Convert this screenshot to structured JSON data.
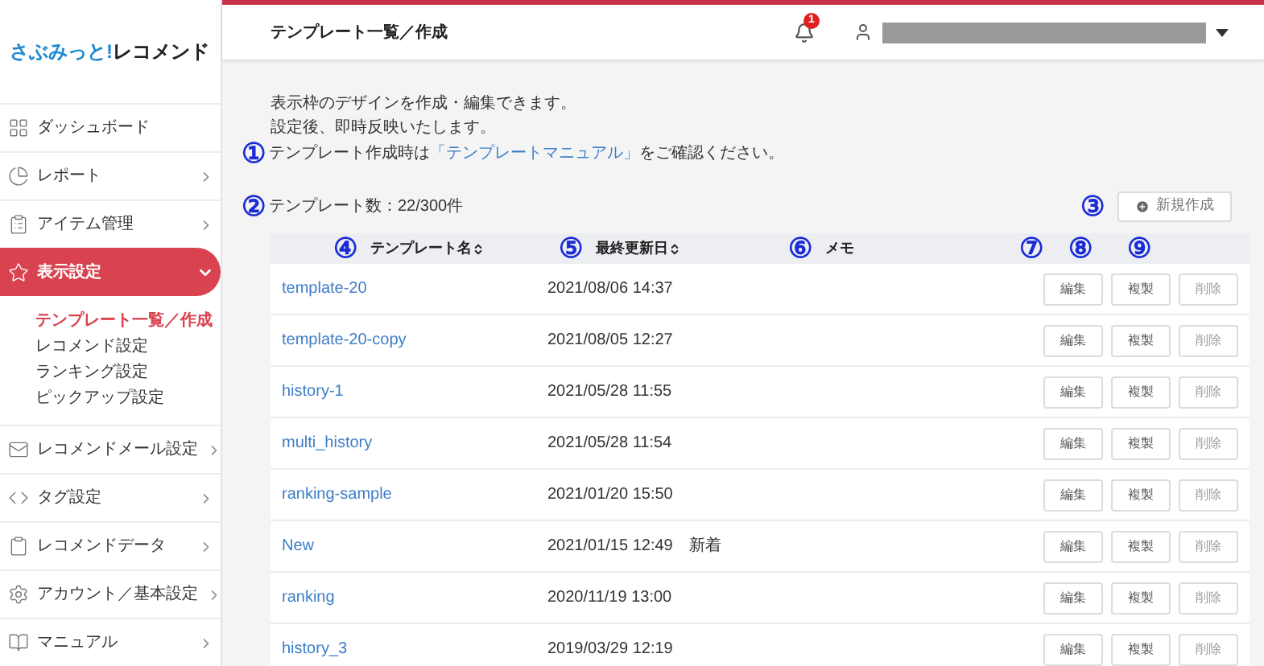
{
  "logo": {
    "accent": "さぶみっと!",
    "name": "レコメンド"
  },
  "sidebar": {
    "items": [
      {
        "label": "ダッシュボード",
        "selected": false
      },
      {
        "label": "レポート",
        "selected": false,
        "expanded": false
      },
      {
        "label": "アイテム管理",
        "selected": false,
        "expanded": false
      },
      {
        "label": "表示設定",
        "selected": true,
        "expanded": true,
        "children": [
          {
            "label": "テンプレート一覧／作成",
            "selected": true
          },
          {
            "label": "レコメンド設定",
            "selected": false
          },
          {
            "label": "ランキング設定",
            "selected": false
          },
          {
            "label": "ピックアップ設定",
            "selected": false
          }
        ]
      },
      {
        "label": "レコメンドメール設定",
        "selected": false,
        "expanded": false
      },
      {
        "label": "タグ設定",
        "selected": false,
        "expanded": false
      },
      {
        "label": "レコメンドデータ",
        "selected": false,
        "expanded": false
      },
      {
        "label": "アカウント／基本設定",
        "selected": false,
        "expanded": false
      },
      {
        "label": "マニュアル",
        "selected": false,
        "expanded": false
      }
    ]
  },
  "header": {
    "title": "テンプレート一覧／作成",
    "notification_count": "1"
  },
  "intro": {
    "lines": [
      "表示枠のデザインを作成・編集できます。",
      "設定後、即時反映いたします。"
    ],
    "note": {
      "annotation": "①",
      "before": "テンプレート作成時は",
      "link": "「テンプレートマニュアル」",
      "after": "をご確認ください。"
    }
  },
  "count": {
    "annotation": "②",
    "text": "テンプレート数：22/300件"
  },
  "new_button": {
    "annotation": "③",
    "label": "新規作成"
  },
  "table": {
    "columns": [
      {
        "annotation": "④",
        "label": "テンプレート名",
        "sortable": true
      },
      {
        "annotation": "⑤",
        "label": "最終更新日",
        "sortable": true
      },
      {
        "annotation": "⑥",
        "label": "メモ",
        "sortable": false
      },
      {
        "annotation": "⑦"
      },
      {
        "annotation": "⑧"
      },
      {
        "annotation": "⑨"
      }
    ],
    "rows": [
      {
        "name": "template-20",
        "updated": "2021/08/06 14:37",
        "actions": [
          "編集",
          "複製",
          "削除"
        ]
      },
      {
        "name": "template-20-copy",
        "updated": "2021/08/05 12:27",
        "actions": [
          "編集",
          "複製",
          "削除"
        ]
      },
      {
        "name": "history-1",
        "updated": "2021/05/28 11:55",
        "actions": [
          "編集",
          "複製",
          "削除"
        ]
      },
      {
        "name": "multi_history",
        "updated": "2021/05/28 11:54",
        "actions": [
          "編集",
          "複製",
          "削除"
        ]
      },
      {
        "name": "ranking-sample",
        "updated": "2021/01/20 15:50",
        "actions": [
          "編集",
          "複製",
          "削除"
        ]
      },
      {
        "name": "New",
        "updated": "2021/01/15 12:49",
        "memo": "新着",
        "actions": [
          "編集",
          "複製",
          "削除"
        ]
      },
      {
        "name": "ranking",
        "updated": "2020/11/19 13:00",
        "actions": [
          "編集",
          "複製",
          "削除"
        ]
      },
      {
        "name": "history_3",
        "updated": "2019/03/29 12:19",
        "actions": [
          "編集",
          "複製",
          "削除"
        ]
      }
    ]
  }
}
